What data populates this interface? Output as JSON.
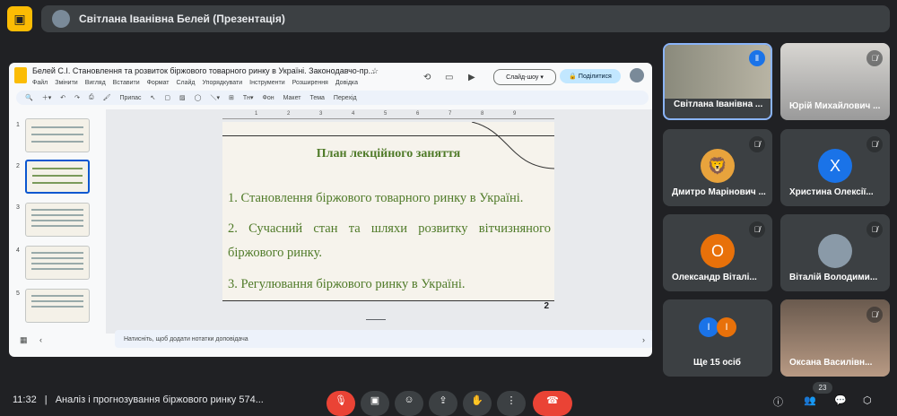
{
  "meeting": {
    "presenter_banner": "Світлана Іванівна Белей (Презентація)",
    "time": "11:32",
    "meeting_name": "Аналіз і прогнозування біржового ринку 574...",
    "participants_count": "23"
  },
  "slides_app": {
    "doc_title": "Белей С.І. Становлення та розвиток біржового товарного ринку в Україні. Законодавчо-пр...",
    "menu": [
      "Файл",
      "Змінити",
      "Вигляд",
      "Вставити",
      "Формат",
      "Слайд",
      "Упорядкувати",
      "Інструменти",
      "Розширення",
      "Довідка"
    ],
    "toolbar": {
      "zoom": "Припас",
      "bg": "Фон",
      "layout": "Макет",
      "theme": "Тема",
      "transition": "Перехід"
    },
    "slideshow_label": "Слайд-шоу",
    "share_label": "Поділитися",
    "notes_placeholder": "Натисніть, щоб додати нотатки доповідача",
    "thumbnails": [
      "1",
      "2",
      "3",
      "4",
      "5"
    ],
    "ruler_numbers": [
      "1",
      "2",
      "3",
      "4",
      "5",
      "6",
      "7",
      "8",
      "9"
    ]
  },
  "slide": {
    "heading": "План лекційного заняття",
    "item1": "1.  Становлення біржового товарного ринку в Україні.",
    "item2": "2.  Сучасний стан та шляхи розвитку вітчизняного біржового ринку.",
    "item3": "3. Регулювання біржового ринку в Україні.",
    "page_number": "2",
    "text_color": "#4f7a28"
  },
  "participants": [
    {
      "name": "Світлана Іванівна ...",
      "initial": "",
      "color": "#5f6368"
    },
    {
      "name": "Юрій Михайлович ...",
      "initial": "",
      "color": "#6b6b6b"
    },
    {
      "name": "Дмитро Марінович ...",
      "initial": "🦁",
      "color": "#e8a33c"
    },
    {
      "name": "Христина Олексії...",
      "initial": "Х",
      "color": "#1a73e8"
    },
    {
      "name": "Олександр Віталі...",
      "initial": "О",
      "color": "#e8710a"
    },
    {
      "name": "Віталій Володими...",
      "initial": "",
      "color": "#8a9aa8"
    },
    {
      "name": "Ще 15 осіб",
      "initial": "І",
      "color": "#e8710a"
    },
    {
      "name": "Оксана Василівн...",
      "initial": "",
      "color": "#9e7f6d"
    }
  ]
}
